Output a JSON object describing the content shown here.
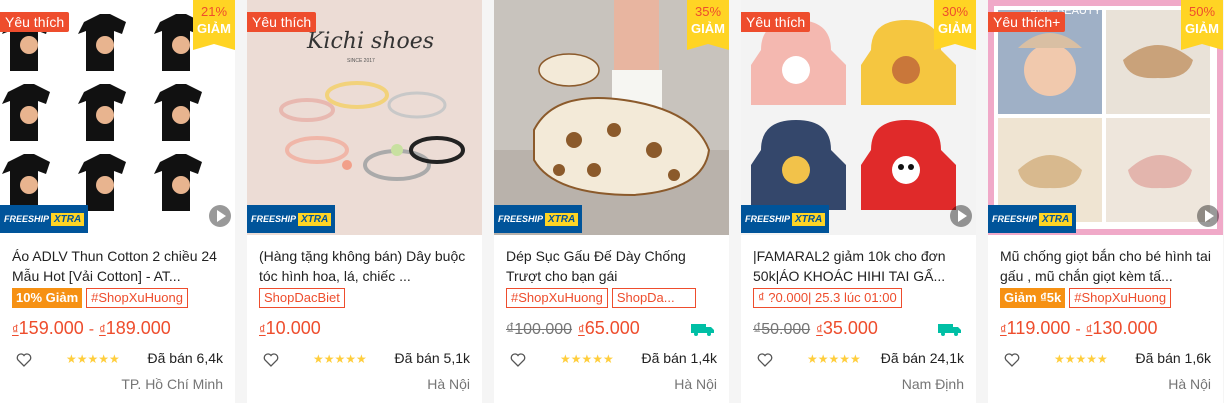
{
  "colors": {
    "accent": "#ee4d2d",
    "badge_yellow": "#ffd424",
    "freeship_blue": "#00549a",
    "star": "#ffce3d"
  },
  "products": [
    {
      "favorite": "Yêu thích",
      "discount_pct": "21%",
      "discount_label": "GIẢM",
      "freeship_text": "FREESHIP",
      "freeship_extra": "XTRA",
      "image_desc": "black t-shirts grid",
      "title": "Áo ADLV Thun Cotton 2 chiều 24 Mẫu Hot [Vải Cotton] - AT...",
      "tags": [
        {
          "text": "10% Giảm",
          "style": "fill"
        },
        {
          "text": "#ShopXuHuong",
          "style": "line"
        }
      ],
      "currency": "₫",
      "price_min": "159.000",
      "price_max": "189.000",
      "old_price": "",
      "free_ship_icon": false,
      "rating_stars": "★★★★★",
      "sold": "Đã bán 6,4k",
      "location": "TP. Hồ Chí Minh"
    },
    {
      "favorite": "Yêu thích",
      "discount_pct": "",
      "discount_label": "",
      "freeship_text": "FREESHIP",
      "freeship_extra": "XTRA",
      "image_desc": "Kichi shoes hair ties",
      "brand_text": "Kichi shoes",
      "brand_sub": "SINCE 2017",
      "title": "(Hàng tặng không bán) Dây buộc tóc hình hoa, lá, chiếc ...",
      "tags": [
        {
          "text": "ShopDacBiet",
          "style": "line"
        }
      ],
      "currency": "₫",
      "price_min": "10.000",
      "price_max": "",
      "old_price": "",
      "free_ship_icon": false,
      "rating_stars": "★★★★★",
      "sold": "Đã bán 5,1k",
      "location": "Hà Nội"
    },
    {
      "favorite": "",
      "discount_pct": "35%",
      "discount_label": "GIẢM",
      "freeship_text": "FREESHIP",
      "freeship_extra": "XTRA",
      "image_desc": "bear print clogs",
      "title": "Dép Sục Gấu Đế Dày Chống Trượt cho bạn gái",
      "tags": [
        {
          "text": "#ShopXuHuong",
          "style": "line"
        },
        {
          "text": "ShopDa...",
          "style": "line"
        }
      ],
      "currency": "₫",
      "price_min": "65.000",
      "price_max": "",
      "old_price": "₫100.000",
      "free_ship_icon": true,
      "rating_stars": "★★★★★",
      "sold": "Đã bán 1,4k",
      "location": "Hà Nội"
    },
    {
      "favorite": "Yêu thích",
      "discount_pct": "30%",
      "discount_label": "GIẢM",
      "freeship_text": "FREESHIP",
      "freeship_extra": "XTRA",
      "image_desc": "kids hooded jackets",
      "title": "|FAMARAL2 giảm 10k cho đơn 50k|ÁO KHOÁC HIHI TAI GẤ...",
      "tags": [
        {
          "text": "₫ ?0.000| 25.3 lúc 01:00",
          "style": "line"
        }
      ],
      "currency": "₫",
      "price_min": "35.000",
      "price_max": "",
      "old_price": "₫50.000",
      "free_ship_icon": true,
      "rating_stars": "★★★★★",
      "sold": "Đã bán 24,1k",
      "location": "Nam Định"
    },
    {
      "favorite": "Yêu thích+",
      "discount_pct": "50%",
      "discount_label": "GIẢM",
      "freeship_text": "FREESHIP",
      "freeship_extra": "XTRA",
      "image_desc": "baby hats with face shield",
      "brand_text": "AME BEAUTY",
      "title": "Mũ chống giọt bắn cho bé hình tai gấu , mũ chắn giọt kèm tấ...",
      "tags": [
        {
          "text": "Giảm ₫5k",
          "style": "fill"
        },
        {
          "text": "#ShopXuHuong",
          "style": "line"
        }
      ],
      "currency": "₫",
      "price_min": "119.000",
      "price_max": "130.000",
      "old_price": "",
      "free_ship_icon": false,
      "rating_stars": "★★★★★",
      "sold": "Đã bán 1,6k",
      "location": "Hà Nội"
    }
  ]
}
